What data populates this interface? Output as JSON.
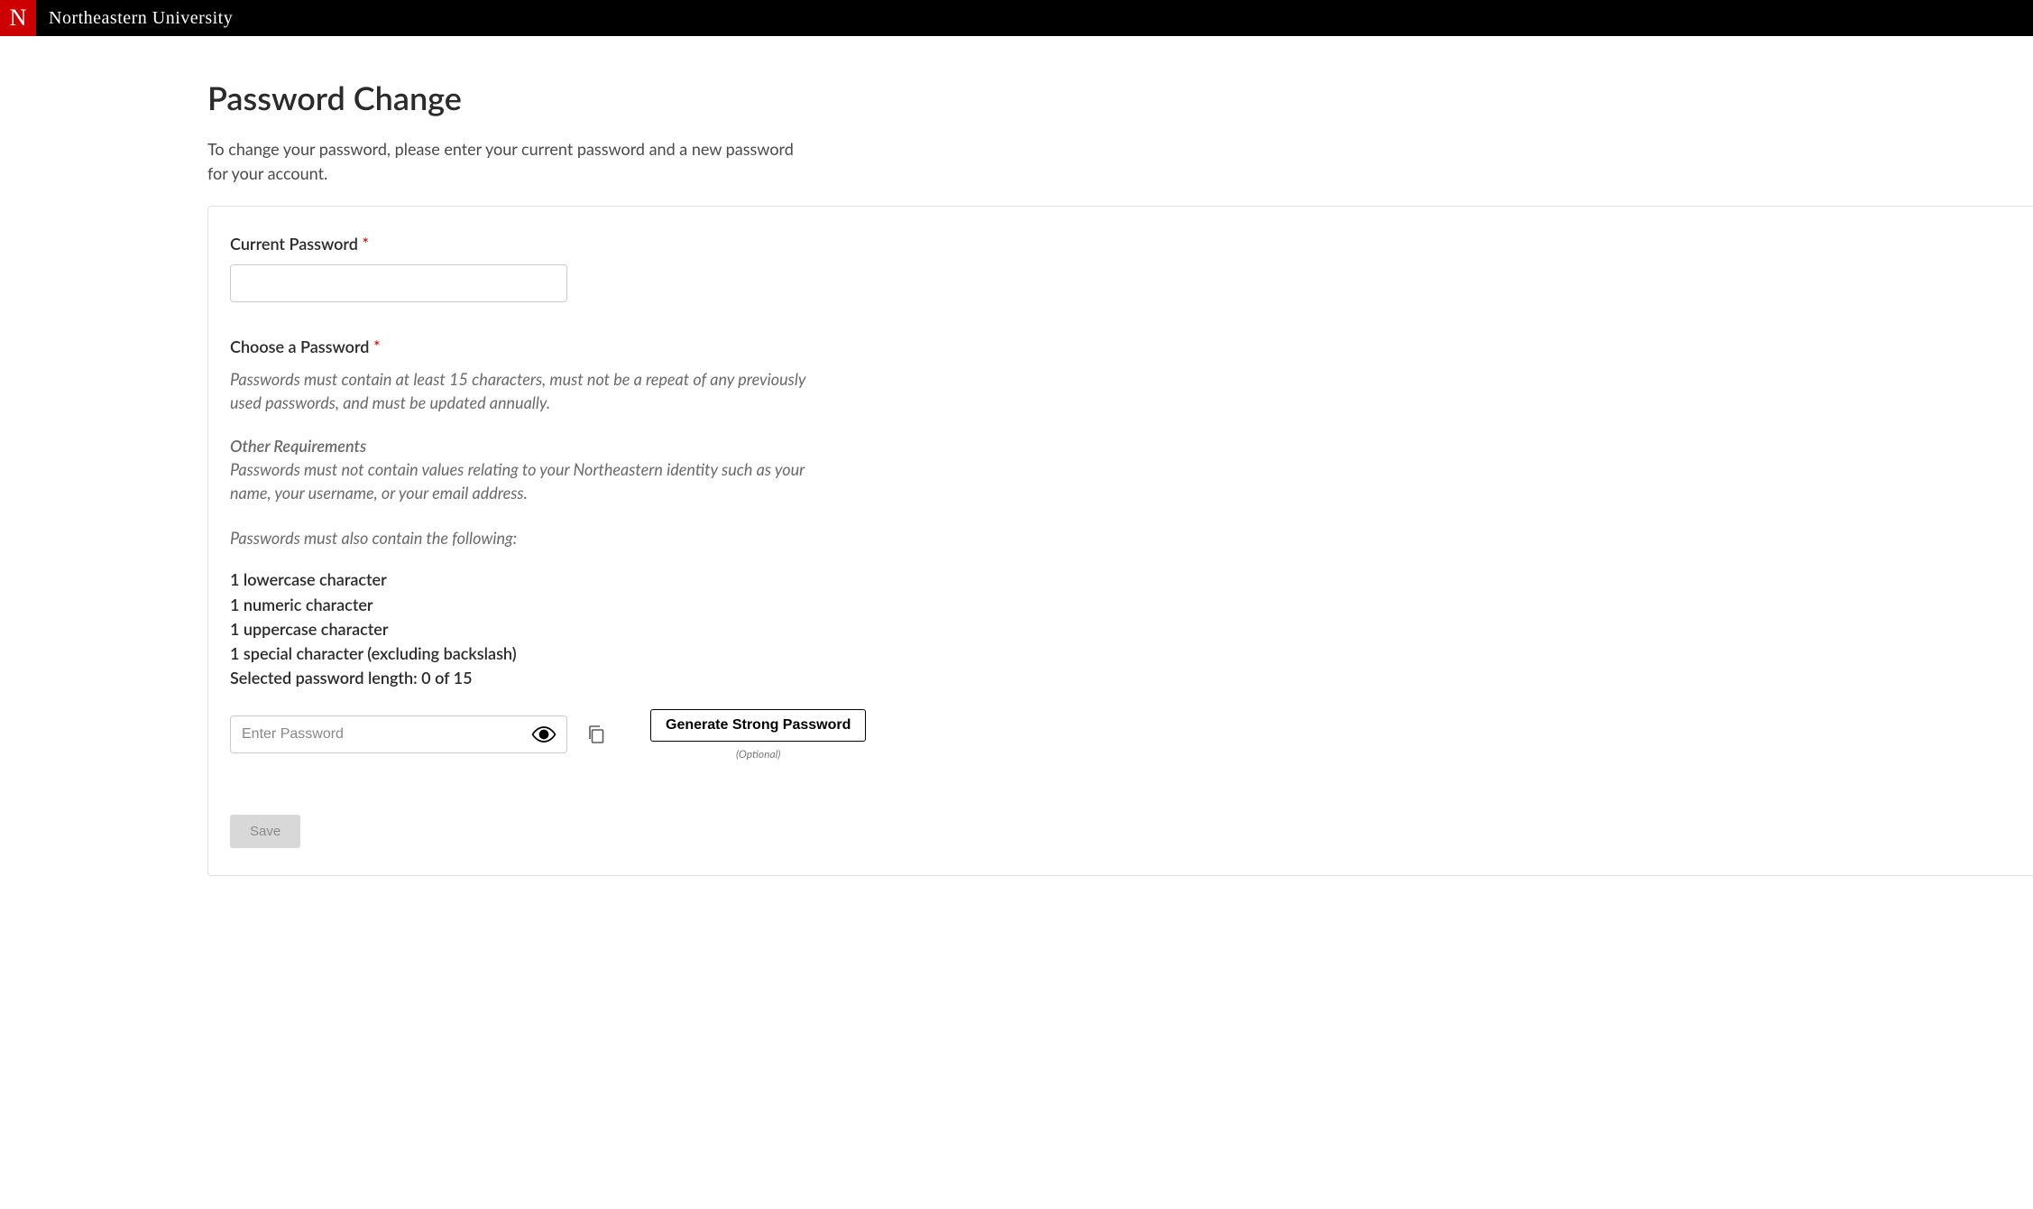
{
  "brand": {
    "logo_letter": "N",
    "name": "Northeastern University"
  },
  "page": {
    "title": "Password Change",
    "intro": "To change your password, please enter your current password and a new password for your account."
  },
  "form": {
    "current_password_label": "Current Password",
    "choose_password_label": "Choose a Password",
    "required_mark": "*",
    "rule_primary": "Passwords must contain at least 15 characters, must not be a repeat of any previously used passwords, and must be updated annually.",
    "other_req_heading": "Other Requirements",
    "rule_identity": "Passwords must not contain values relating to your Northeastern identity such as your name, your username, or your email address.",
    "rule_contain_heading": "Passwords must also contain the following:",
    "requirements": [
      "1 lowercase character",
      "1 numeric character",
      "1 uppercase character",
      "1 special character (excluding backslash)",
      "Selected password length: 0 of 15"
    ],
    "new_password_placeholder": "Enter Password",
    "generate_button": "Generate Strong Password",
    "optional_hint": "(Optional)",
    "save_button": "Save"
  }
}
